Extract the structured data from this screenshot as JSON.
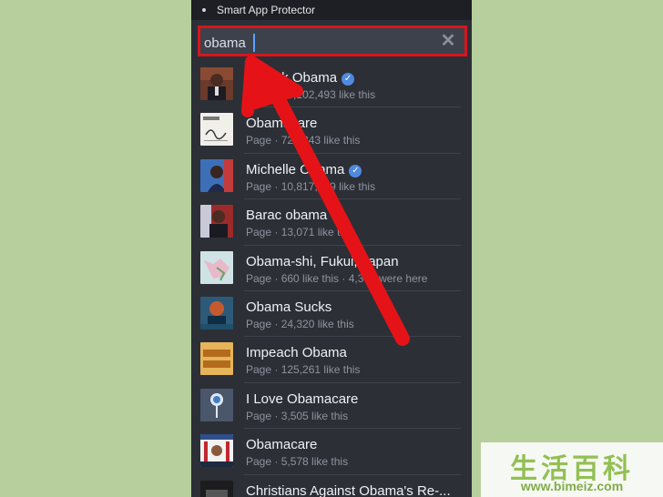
{
  "status_bar": {
    "title": "Smart App Protector"
  },
  "search": {
    "value": "obama"
  },
  "results": [
    {
      "name": "Barack Obama",
      "meta": "Page · 43,102,493 like this",
      "verified": true
    },
    {
      "name": "Obamacare",
      "meta": "Page · 721,343 like this",
      "verified": false
    },
    {
      "name": "Michelle Obama",
      "meta": "Page · 10,817,579 like this",
      "verified": true
    },
    {
      "name": "Barac obama",
      "meta": "Page · 13,071 like this",
      "verified": false
    },
    {
      "name": "Obama-shi, Fukui, Japan",
      "meta": "Page · 660 like this · 4,380 were here",
      "verified": false
    },
    {
      "name": "Obama Sucks",
      "meta": "Page · 24,320 like this",
      "verified": false
    },
    {
      "name": "Impeach Obama",
      "meta": "Page · 125,261 like this",
      "verified": false
    },
    {
      "name": "I Love Obamacare",
      "meta": "Page · 3,505 like this",
      "verified": false
    },
    {
      "name": "Obamacare",
      "meta": "Page · 5,578 like this",
      "verified": false
    },
    {
      "name": "Christians Against Obama's Re-...",
      "meta": "",
      "verified": false
    }
  ],
  "watermark": {
    "text": "生活百科",
    "url": "www.bimeiz.com"
  },
  "colors": {
    "highlight": "#d9141b",
    "verified": "#4f8ae0",
    "background": "#b7cf9c"
  }
}
